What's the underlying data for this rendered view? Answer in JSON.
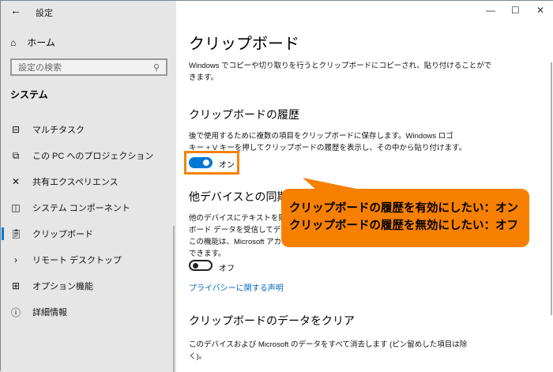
{
  "window": {
    "title": "設定",
    "controls": [
      "—",
      "☐",
      "✕"
    ]
  },
  "sidebar": {
    "home": "ホーム",
    "search_placeholder": "設定の検索",
    "section": "システム",
    "items": [
      {
        "label": "マルチタスク",
        "icon": "multitask-icon"
      },
      {
        "label": "この PC へのプロジェクション",
        "icon": "projection-icon"
      },
      {
        "label": "共有エクスペリエンス",
        "icon": "shared-experience-icon"
      },
      {
        "label": "システム コンポーネント",
        "icon": "system-components-icon"
      },
      {
        "label": "クリップボード",
        "icon": "clipboard-icon"
      },
      {
        "label": "リモート デスクトップ",
        "icon": "remote-desktop-icon"
      },
      {
        "label": "オプション機能",
        "icon": "optional-features-icon"
      },
      {
        "label": "詳細情報",
        "icon": "info-icon"
      }
    ],
    "active": "クリップボード"
  },
  "main": {
    "title": "クリップボード",
    "intro": [
      "Windows でコピーや切り取りを行うとクリップボードにコピーされ、貼り付けることがで",
      "きます。"
    ],
    "history": {
      "heading": "クリップボードの履歴",
      "desc": [
        "後で使用するために複数の項目をクリップボードに保存します。Windows ロゴ",
        "キー + V キーを押してクリップボードの履歴を表示し、その中から貼り付けます。"
      ],
      "toggle": "オン"
    },
    "sync": {
      "heading": "他デバイスとの同期",
      "desc": [
        "他のデバイスにテキストを貼り付",
        "ボード データを受信してデバイス",
        "この機能は、Microsoft アカウ",
        "できます。"
      ],
      "toggle": "オフ",
      "link": "プライバシーに関する声明"
    },
    "clear": {
      "heading": "クリップボードのデータをクリア",
      "desc": [
        "このデバイスおよび Microsoft のデータをすべて消去します (ピン留めした項目は除",
        "く)。"
      ]
    }
  },
  "callout": {
    "line1": "クリップボードの履歴を有効にしたい：オン",
    "line2": "クリップボードの履歴を無効にしたい：オフ",
    "color": "#f78000"
  }
}
